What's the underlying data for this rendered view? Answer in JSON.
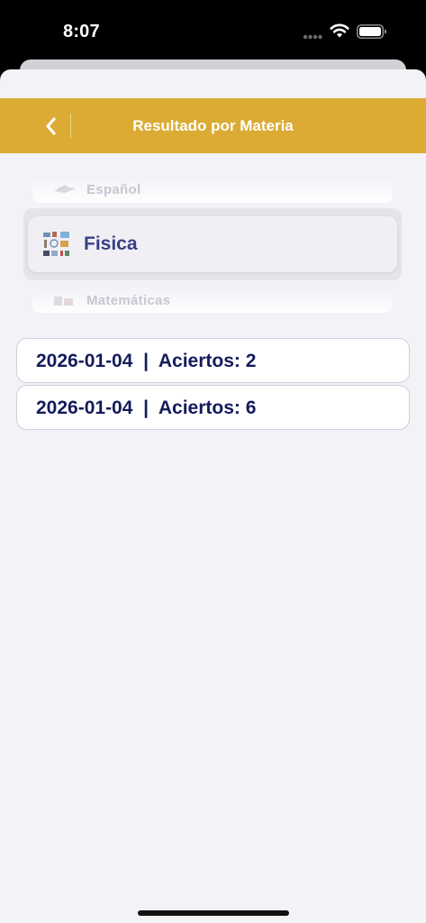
{
  "status_bar": {
    "time": "8:07"
  },
  "nav": {
    "title": "Resultado por Materia",
    "back_icon": "chevron-left-icon"
  },
  "picker": {
    "items": [
      {
        "label": "Español",
        "icon": "book-thumb-icon"
      },
      {
        "label": "Fisica",
        "icon": "physics-thumb-icon"
      },
      {
        "label": "Matemáticas",
        "icon": "math-thumb-icon"
      }
    ],
    "selected": "Fisica"
  },
  "results": [
    {
      "text": "2026-01-04  |  Aciertos: 2"
    },
    {
      "text": "2026-01-04  |  Aciertos: 6"
    }
  ],
  "colors": {
    "nav_background": "#dbab34",
    "sheet_background": "#f2f2f7",
    "selected_label": "#3a3f86",
    "result_text": "#141b5c"
  }
}
